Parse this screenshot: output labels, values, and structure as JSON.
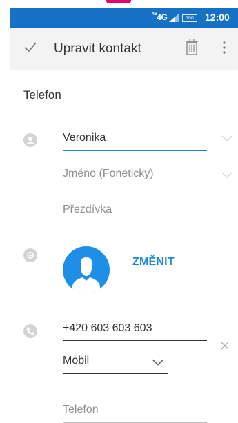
{
  "status_bar": {
    "network": "4G",
    "network_prefix": "46",
    "battery": "100",
    "time": "12:00",
    "background_color": "#1670c4"
  },
  "app_bar": {
    "title": "Upravit kontakt",
    "confirm_icon": "check-icon",
    "delete_icon": "trash-icon",
    "menu_icon": "more-vertical-icon"
  },
  "section": {
    "title": "Telefon"
  },
  "name": {
    "icon": "person-icon",
    "first_name_value": "Veronika",
    "phonetic_placeholder": "Jméno (Foneticky)",
    "nickname_placeholder": "Přezdívka"
  },
  "photo": {
    "icon": "camera-icon",
    "avatar_icon": "avatar-silhouette-icon",
    "change_label": "ZMĚNIT"
  },
  "phone": {
    "icon": "phone-icon",
    "value": "+420 603 603 603",
    "type_selected": "Mobil",
    "new_placeholder": "Telefon",
    "clear_icon": "close-icon"
  },
  "colors": {
    "accent": "#1e88d6",
    "avatar_bg": "#1e8fe6",
    "brand_notch": "#e5006e"
  }
}
